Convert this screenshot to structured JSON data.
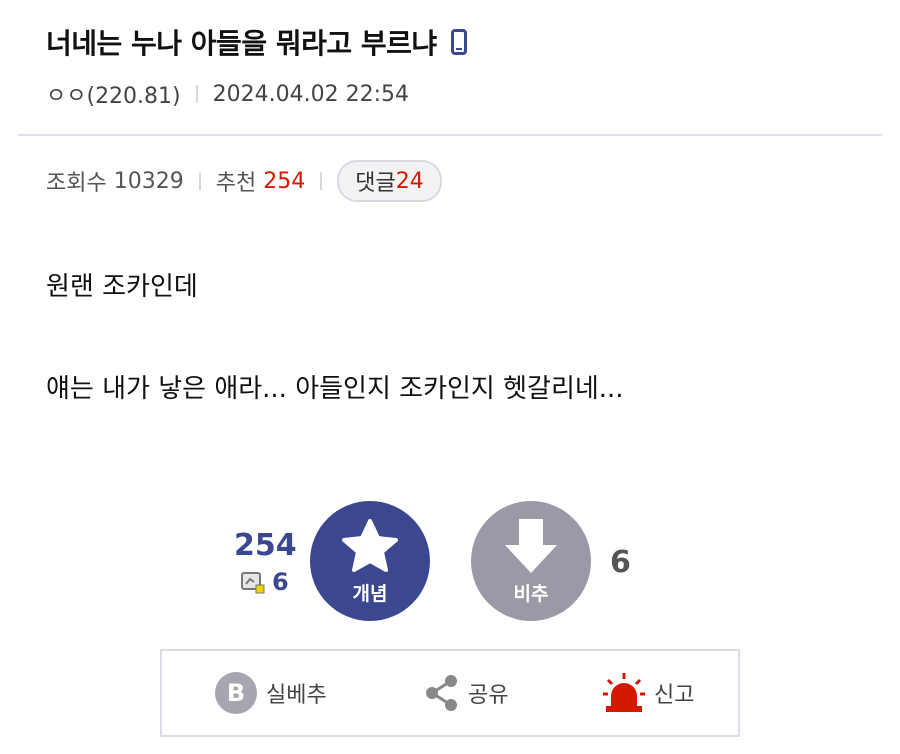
{
  "post": {
    "title": "너네는 누나 아들을 뭐라고 부르냐",
    "author": "ㅇㅇ(220.81)",
    "datetime": "2024.04.02 22:54"
  },
  "stats": {
    "views_label": "조회수",
    "views": "10329",
    "recommend_label": "추천",
    "recommend": "254",
    "comments_label": "댓글",
    "comments": "24"
  },
  "body": {
    "line1": "원랜 조카인데",
    "line2": "얘는 내가 낳은 애라... 아들인지 조카인지 헷갈리네..."
  },
  "vote": {
    "up_count": "254",
    "fix_count": "6",
    "up_label": "개념",
    "down_label": "비추",
    "down_count": "6"
  },
  "actions": {
    "silbe_label": "실베추",
    "share_label": "공유",
    "report_label": "신고"
  },
  "colors": {
    "accent": "#3b4890",
    "red": "#d31900",
    "gray_button": "#9a9aa6"
  },
  "icons": [
    "mobile-phone-icon",
    "star-icon",
    "arrow-down-icon",
    "fix-icon",
    "b-badge-icon",
    "share-icon",
    "siren-icon"
  ]
}
